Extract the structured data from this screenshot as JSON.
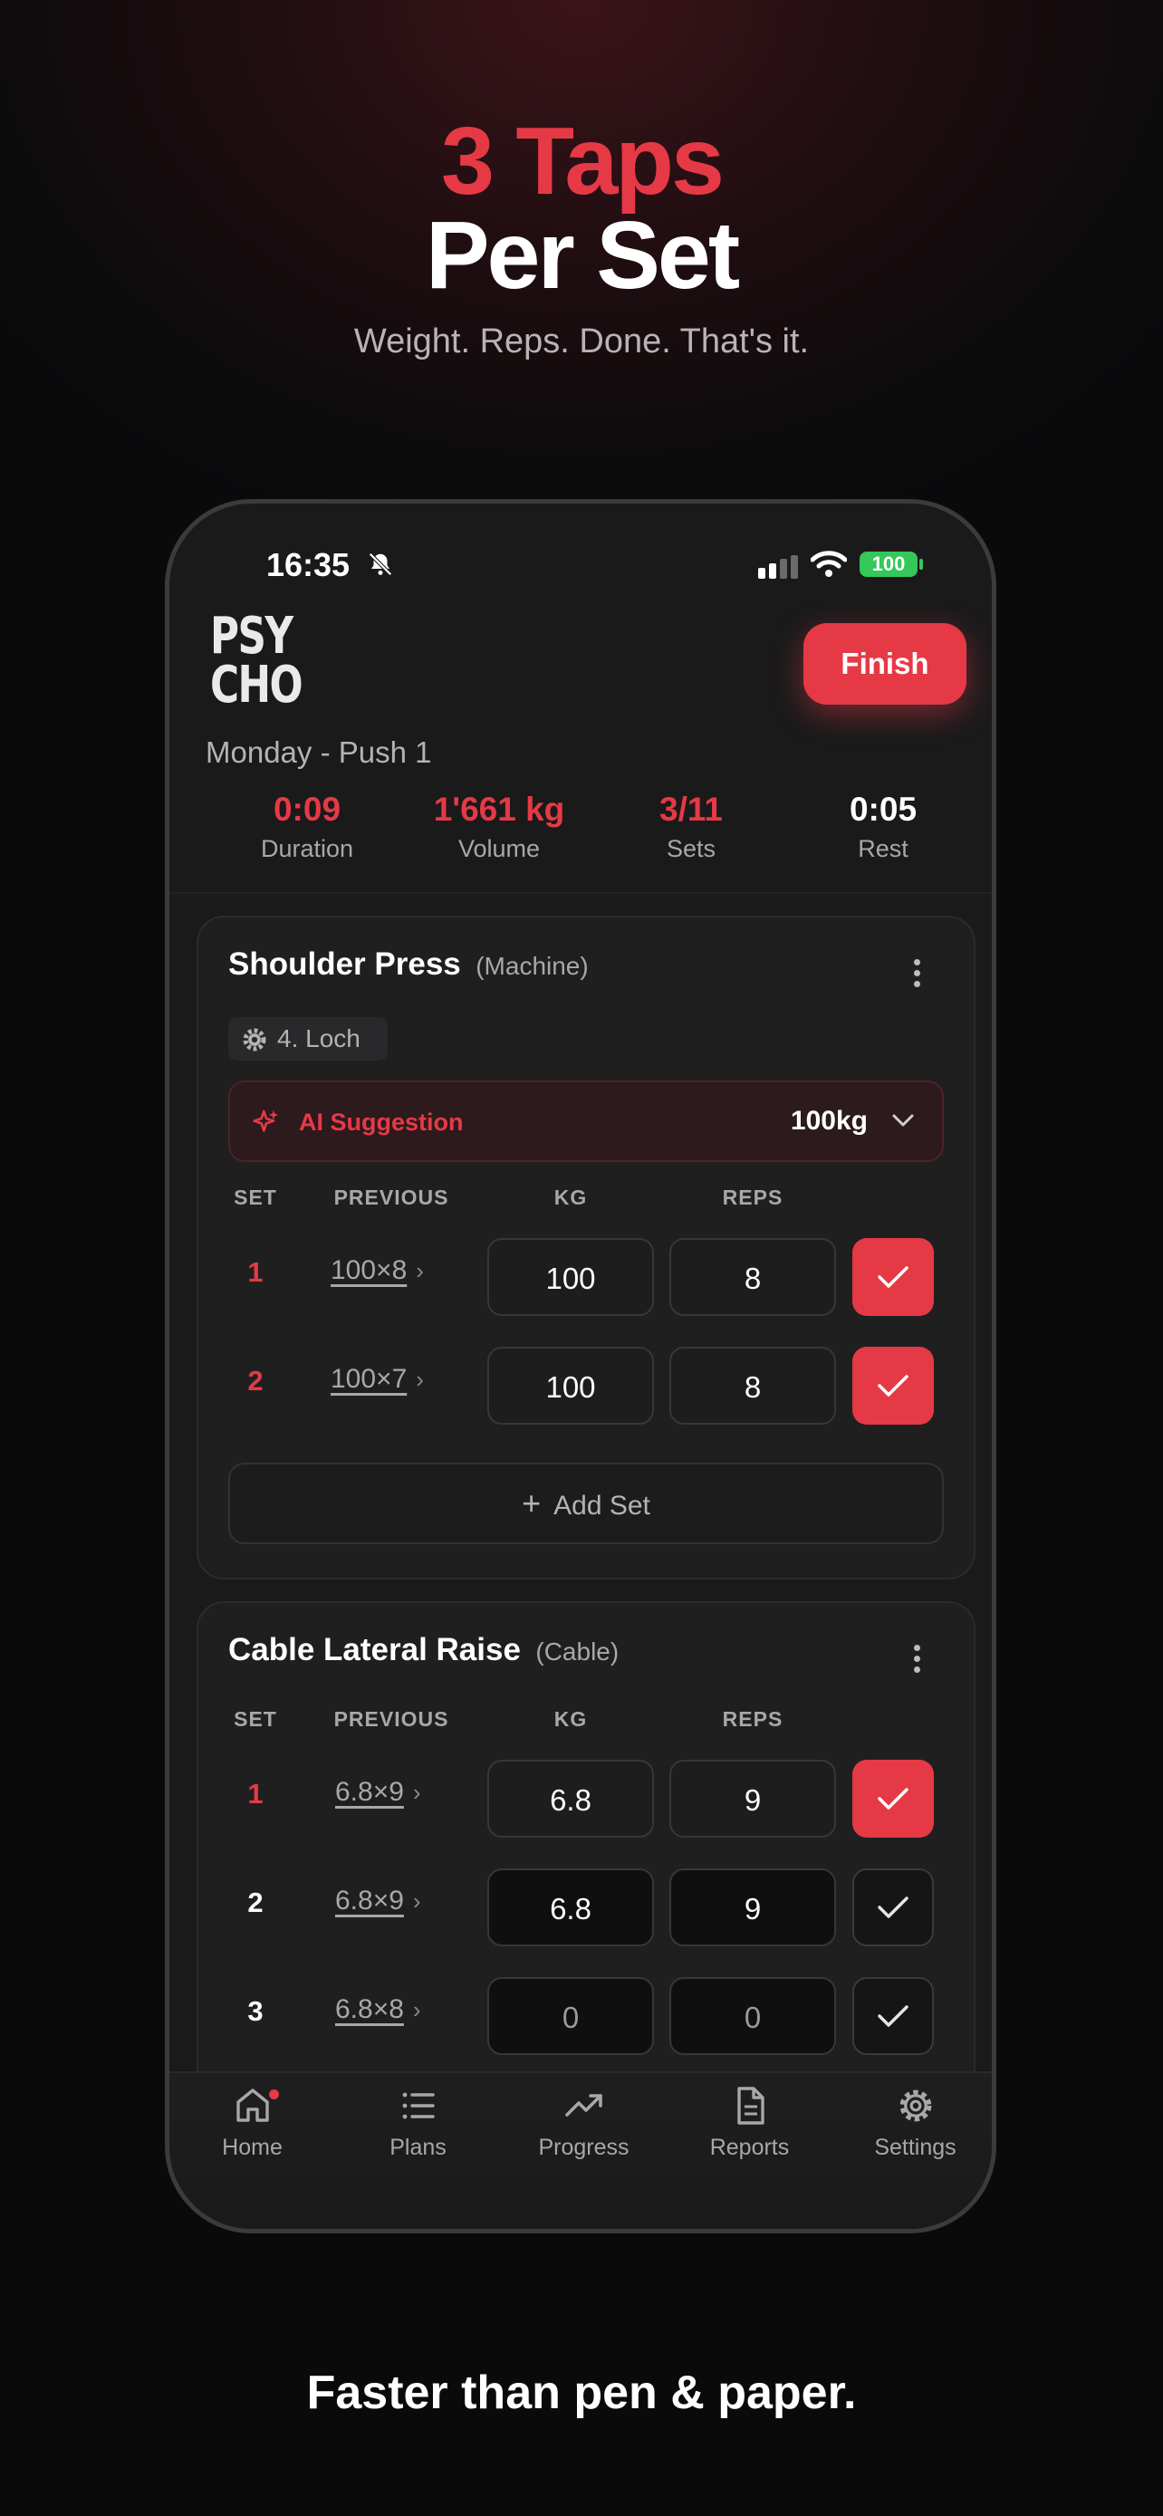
{
  "promo": {
    "headline_line1": "3 Taps",
    "headline_line2": "Per Set",
    "subtitle": "Weight. Reps. Done. That's it.",
    "footer": "Faster than pen & paper."
  },
  "status_bar": {
    "time": "16:35",
    "battery": "100"
  },
  "app": {
    "logo_line1": "PSY",
    "logo_line2": "CHO",
    "finish_label": "Finish",
    "workout_name": "Monday - Push 1",
    "accent_color": "#e63946"
  },
  "stats": [
    {
      "value": "0:09",
      "label": "Duration"
    },
    {
      "value": "1'661 kg",
      "label": "Volume"
    },
    {
      "value": "3/11",
      "label": "Sets"
    },
    {
      "value": "0:05",
      "label": "Rest"
    }
  ],
  "columns": {
    "set": "SET",
    "previous": "PREVIOUS",
    "kg": "KG",
    "reps": "REPS"
  },
  "exercises": [
    {
      "name": "Shoulder Press",
      "type": "(Machine)",
      "setting": "4. Loch",
      "ai_label": "AI Suggestion",
      "ai_value": "100kg",
      "add_set": "Add Set",
      "sets": [
        {
          "num": "1",
          "previous": "100×8",
          "kg": "100",
          "reps": "8",
          "done": true
        },
        {
          "num": "2",
          "previous": "100×7",
          "kg": "100",
          "reps": "8",
          "done": true
        }
      ]
    },
    {
      "name": "Cable Lateral Raise",
      "type": "(Cable)",
      "sets": [
        {
          "num": "1",
          "previous": "6.8×9",
          "kg": "6.8",
          "reps": "9",
          "done": true
        },
        {
          "num": "2",
          "previous": "6.8×9",
          "kg": "6.8",
          "reps": "9",
          "done": false
        },
        {
          "num": "3",
          "previous": "6.8×8",
          "kg": "0",
          "reps": "0",
          "done": false
        }
      ]
    }
  ],
  "tabbar": [
    {
      "label": "Home",
      "icon": "home-icon"
    },
    {
      "label": "Plans",
      "icon": "list-icon"
    },
    {
      "label": "Progress",
      "icon": "trend-up-icon"
    },
    {
      "label": "Reports",
      "icon": "document-icon"
    },
    {
      "label": "Settings",
      "icon": "gear-icon"
    }
  ]
}
